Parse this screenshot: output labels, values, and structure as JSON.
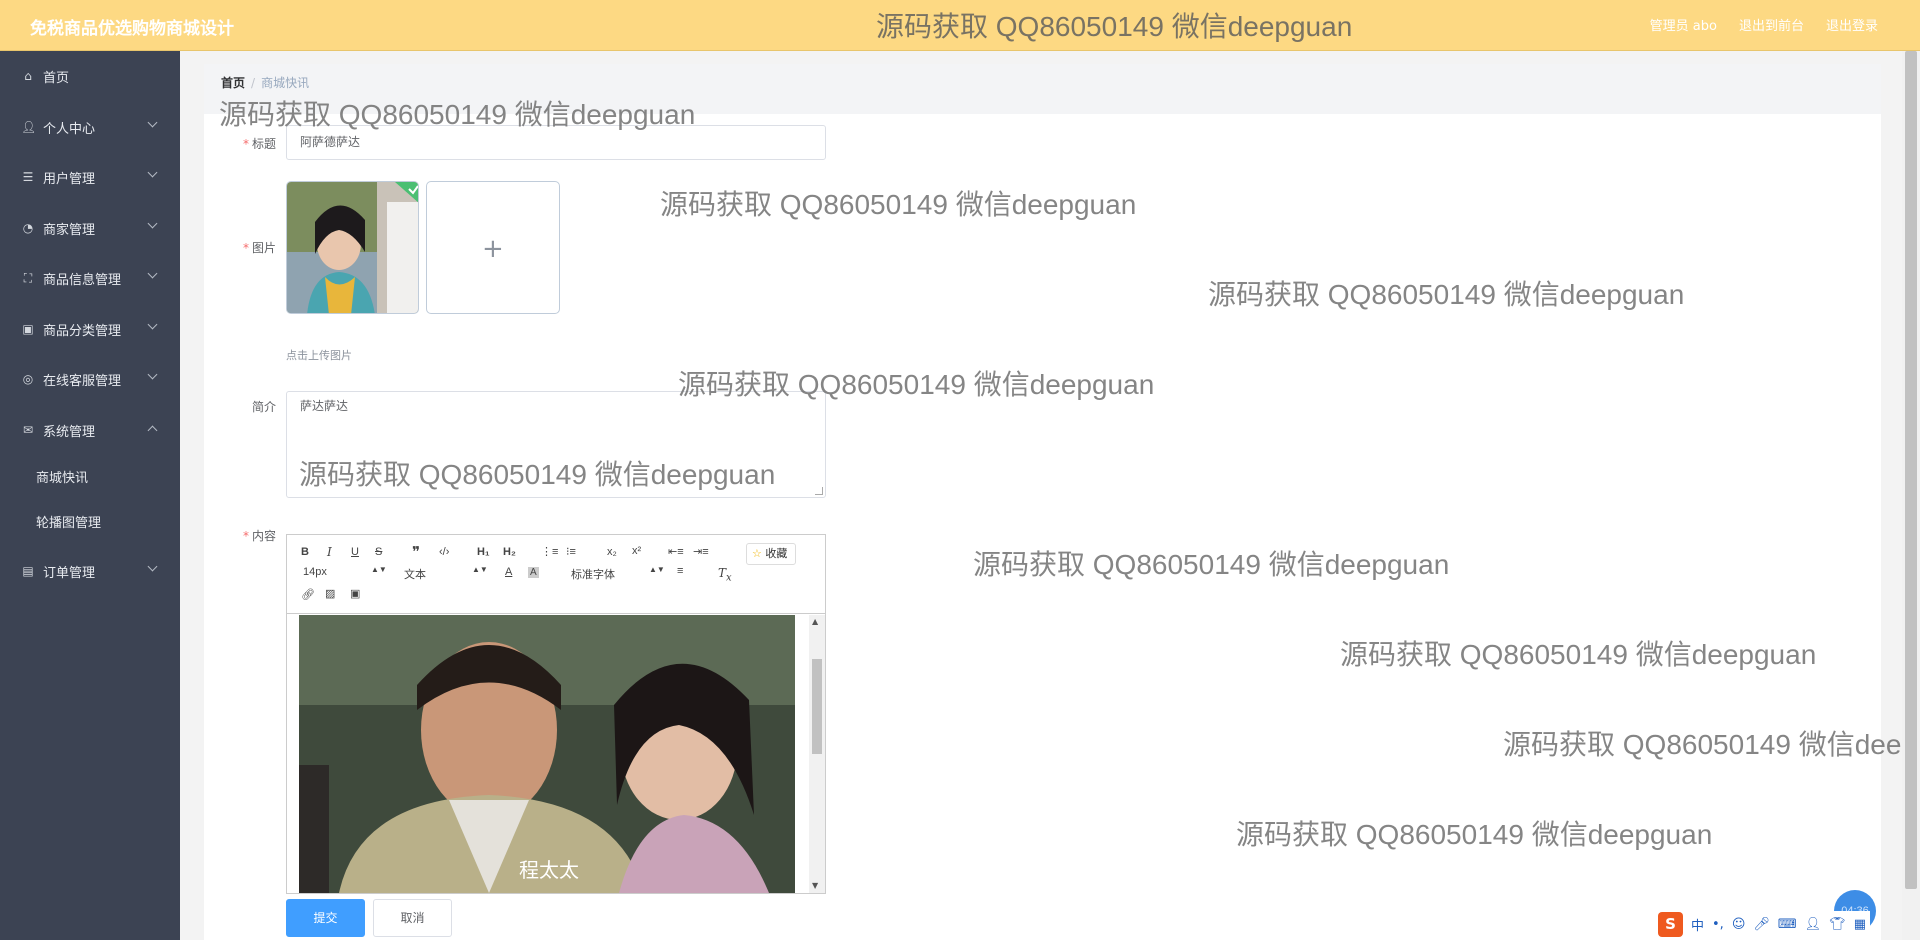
{
  "header": {
    "app_title": "免税商品优选购物商城设计",
    "admin_label": "管理员 abo",
    "exit_frontend": "退出到前台",
    "logout": "退出登录"
  },
  "sidebar": {
    "items": [
      {
        "label": "首页",
        "icon": "home-icon"
      },
      {
        "label": "个人中心",
        "icon": "user-icon"
      },
      {
        "label": "用户管理",
        "icon": "list-icon"
      },
      {
        "label": "商家管理",
        "icon": "compass-icon"
      },
      {
        "label": "商品信息管理",
        "icon": "crop-icon"
      },
      {
        "label": "商品分类管理",
        "icon": "clipboard-icon"
      },
      {
        "label": "在线客服管理",
        "icon": "target-icon"
      },
      {
        "label": "系统管理",
        "icon": "mail-icon"
      },
      {
        "label": "订单管理",
        "icon": "document-icon"
      }
    ],
    "sub_items": [
      "商城快讯",
      "轮播图管理"
    ]
  },
  "breadcrumb": {
    "home": "首页",
    "current": "商城快讯"
  },
  "form": {
    "title_label": "标题",
    "title_value": "阿萨德萨达",
    "image_label": "图片",
    "upload_tip": "点击上传图片",
    "intro_label": "简介",
    "intro_value": "萨达萨达",
    "content_label": "内容"
  },
  "editor": {
    "font_size": "14px",
    "text_style": "文本",
    "font_family": "标准字体",
    "favorite_label": "收藏",
    "image_caption": "程太太"
  },
  "buttons": {
    "submit": "提交",
    "cancel": "取消"
  },
  "watermark": "源码获取 QQ86050149 微信deepguan",
  "clock": "04:36",
  "ime": {
    "lang": "中",
    "punct": "•,"
  },
  "colors": {
    "header": "#fdd983",
    "sidebar": "#3c4353",
    "primary": "#409eff",
    "required": "#f56c6c"
  }
}
